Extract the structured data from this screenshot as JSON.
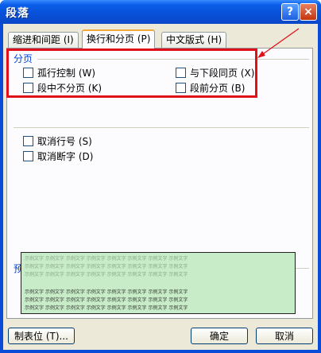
{
  "window": {
    "title": "段落"
  },
  "titlebar": {
    "help_icon": "?",
    "close_icon": "×"
  },
  "tabs": [
    {
      "label": "缩进和间距 (I)"
    },
    {
      "label": "换行和分页 (P)"
    },
    {
      "label": "中文版式 (H)"
    }
  ],
  "pagination": {
    "group_label": "分页",
    "options": [
      {
        "label": "孤行控制 (W)"
      },
      {
        "label": "与下段同页 (X)"
      },
      {
        "label": "段中不分页 (K)"
      },
      {
        "label": "段前分页 (B)"
      }
    ]
  },
  "suppress": {
    "options": [
      {
        "label": "取消行号 (S)"
      },
      {
        "label": "取消断字 (D)"
      }
    ]
  },
  "preview": {
    "label": "预览",
    "sample_text": "示例文字 示例文字 示例文字 示例文字 示例文字 示例文字 示例文字 示例文字"
  },
  "buttons": {
    "tabs_label": "制表位 (T)...",
    "ok_label": "确定",
    "cancel_label": "取消"
  },
  "colors": {
    "highlight": "#e0101a",
    "preview_bg": "#c8ecc8"
  }
}
